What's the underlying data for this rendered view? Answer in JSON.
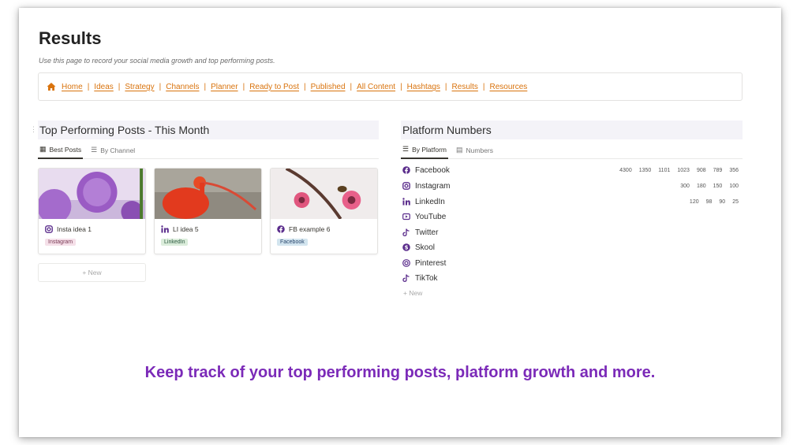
{
  "page": {
    "title": "Results",
    "subtitle": "Use this page to record your social media growth and top performing posts."
  },
  "nav": {
    "home_icon": "home-icon",
    "links": [
      "Home",
      "Ideas",
      "Strategy",
      "Channels",
      "Planner",
      "Ready to Post",
      "Published",
      "All Content",
      "Hashtags",
      "Results",
      "Resources"
    ],
    "accent_color": "#d9730d"
  },
  "top_posts": {
    "title": "Top Performing Posts - This Month",
    "tabs": [
      {
        "label": "Best Posts",
        "icon": "gallery-icon",
        "active": true
      },
      {
        "label": "By Channel",
        "icon": "list-icon",
        "active": false
      }
    ],
    "cards": [
      {
        "title": "Insta idea 1",
        "icon": "instagram-icon",
        "tag": "Instagram",
        "tag_bg": "#f5e0e9",
        "tag_color": "#7a3b55"
      },
      {
        "title": "LI idea 5",
        "icon": "linkedin-icon",
        "tag": "LinkedIn",
        "tag_bg": "#dbeddb",
        "tag_color": "#2b593f"
      },
      {
        "title": "FB example 6",
        "icon": "facebook-icon",
        "tag": "Facebook",
        "tag_bg": "#d3e5ef",
        "tag_color": "#28456c"
      }
    ],
    "new_label": "+ New"
  },
  "platforms": {
    "title": "Platform Numbers",
    "tabs": [
      {
        "label": "By Platform",
        "icon": "list-icon",
        "active": true
      },
      {
        "label": "Numbers",
        "icon": "table-icon",
        "active": false
      }
    ],
    "rows": [
      {
        "name": "Facebook",
        "icon": "facebook-icon",
        "numbers": [
          "4300",
          "1350",
          "1101",
          "1023",
          "908",
          "789",
          "356"
        ]
      },
      {
        "name": "Instagram",
        "icon": "instagram-icon",
        "numbers": [
          "300",
          "180",
          "150",
          "100"
        ]
      },
      {
        "name": "LinkedIn",
        "icon": "linkedin-icon",
        "numbers": [
          "120",
          "98",
          "90",
          "25"
        ]
      },
      {
        "name": "YouTube",
        "icon": "youtube-icon",
        "numbers": []
      },
      {
        "name": "Twitter",
        "icon": "tiktok-icon",
        "numbers": []
      },
      {
        "name": "Skool",
        "icon": "dollar-circle-icon",
        "numbers": []
      },
      {
        "name": "Pinterest",
        "icon": "pinterest-icon",
        "numbers": []
      },
      {
        "name": "TikTok",
        "icon": "tiktok-icon",
        "numbers": []
      }
    ],
    "new_label": "+ New",
    "icon_color": "#5b2d8c"
  },
  "promo": {
    "text": "Keep track of your top performing posts, platform growth and more.",
    "color": "#7b2ab8"
  }
}
